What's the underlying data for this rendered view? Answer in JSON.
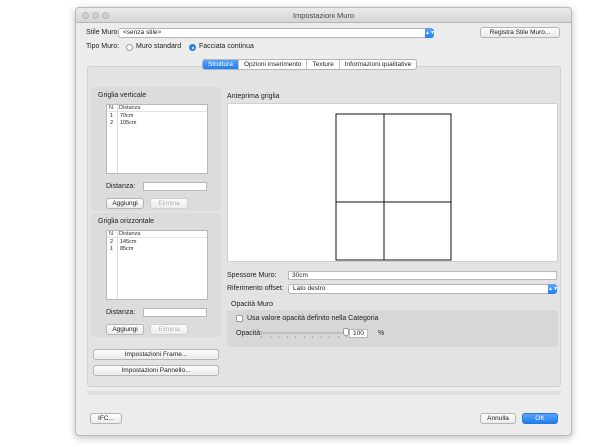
{
  "window": {
    "title": "Impostazioni Muro"
  },
  "stile_muro": {
    "label": "Stile Muro:",
    "value": "<senza stile>",
    "register_button": "Registra Stile Muro..."
  },
  "tipo_muro": {
    "label": "Tipo Muro:",
    "options": [
      {
        "label": "Muro standard",
        "selected": false
      },
      {
        "label": "Facciata continua",
        "selected": true
      }
    ]
  },
  "tabs": [
    {
      "label": "Struttura",
      "active": true
    },
    {
      "label": "Opzioni inserimento",
      "active": false
    },
    {
      "label": "Texture",
      "active": false
    },
    {
      "label": "Informazioni qualitative",
      "active": false
    }
  ],
  "griglia_verticale": {
    "title": "Griglia verticale",
    "columns": [
      "N.",
      "Distanza"
    ],
    "rows": [
      {
        "n": "1",
        "distanza": "70cm"
      },
      {
        "n": "2",
        "distanza": "105cm"
      }
    ],
    "distance_label": "Distanza:",
    "distance_value": "",
    "add_button": "Aggiungi",
    "remove_button": "Elimina"
  },
  "griglia_orizzontale": {
    "title": "Griglia orizzontale",
    "columns": [
      "N.",
      "Distanza"
    ],
    "rows": [
      {
        "n": "2",
        "distanza": "145cm"
      },
      {
        "n": "1",
        "distanza": "85cm"
      }
    ],
    "distance_label": "Distanza:",
    "distance_value": "",
    "add_button": "Aggiungi",
    "remove_button": "Elimina"
  },
  "frame_button": "Impostazioni Frame...",
  "pannello_button": "Impostazioni Pannello...",
  "anteprima": {
    "title": "Anteprima griglia"
  },
  "spessore": {
    "label": "Spessore Muro:",
    "value": "30cm"
  },
  "riferimento": {
    "label": "Riferimento offset:",
    "value": "Lato destro"
  },
  "opacita_muro": {
    "title": "Opacità Muro",
    "checkbox_label": "Usa valore opacità definito nella Categoria",
    "checked": false,
    "opacity_label": "Opacità:",
    "opacity_value": "100",
    "opacity_unit": "%",
    "slider_level": 1.0
  },
  "footer": {
    "ifc_button": "IFC...",
    "cancel_button": "Annulla",
    "ok_button": "OK"
  },
  "colors": {
    "accent": "#1e7ff2",
    "window_bg": "#ececec",
    "panel_bg": "#e3e3e3"
  }
}
